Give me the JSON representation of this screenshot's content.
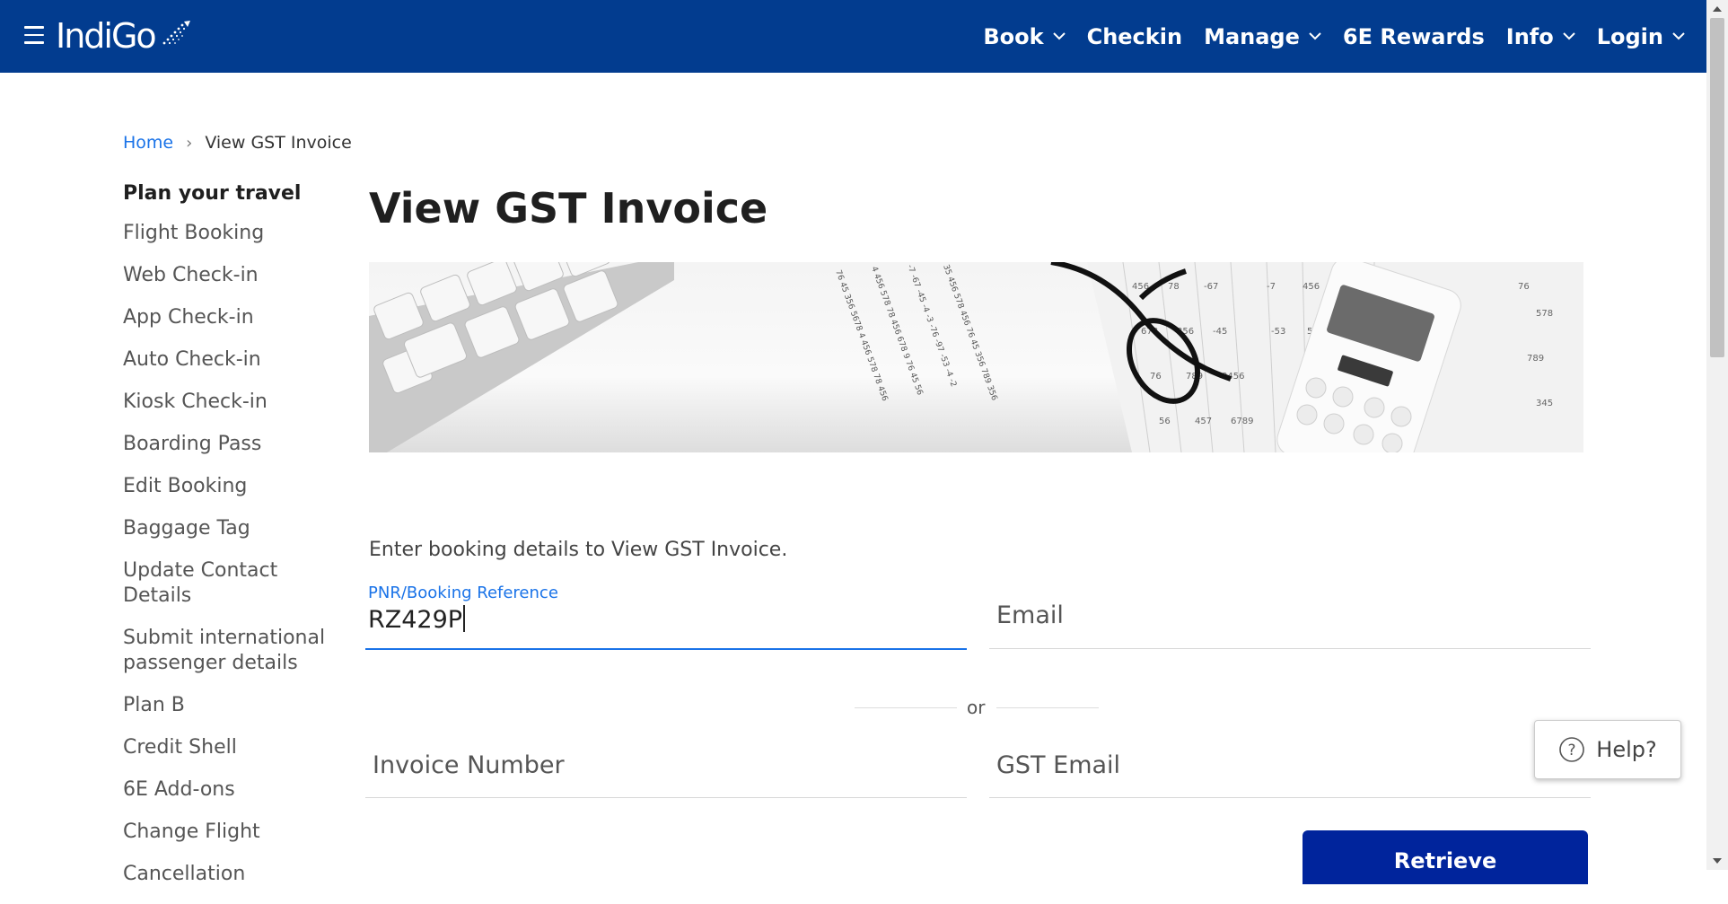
{
  "header": {
    "logo_text": "IndiGo",
    "nav": [
      {
        "label": "Book",
        "has_dropdown": true
      },
      {
        "label": "Checkin",
        "has_dropdown": false
      },
      {
        "label": "Manage",
        "has_dropdown": true
      },
      {
        "label": "6E Rewards",
        "has_dropdown": false
      },
      {
        "label": "Info",
        "has_dropdown": true
      },
      {
        "label": "Login",
        "has_dropdown": true
      }
    ],
    "bg_color": "#023c8f"
  },
  "breadcrumb": {
    "home": "Home",
    "separator": "›",
    "current": "View GST Invoice"
  },
  "sidebar": {
    "title": "Plan your travel",
    "items": [
      "Flight Booking",
      "Web Check-in",
      "App Check-in",
      "Auto Check-in",
      "Kiosk Check-in",
      "Boarding Pass",
      "Edit Booking",
      "Baggage Tag",
      "Update Contact Details",
      "Submit international passenger details",
      "Plan B",
      "Credit Shell",
      "6E Add-ons",
      "Change Flight",
      "Cancellation"
    ]
  },
  "main": {
    "title": "View GST Invoice",
    "instructions": "Enter booking details to View GST Invoice.",
    "pnr_label": "PNR/Booking Reference",
    "pnr_value": "RZ429P",
    "email_placeholder": "Email",
    "or_text": "or",
    "invoice_placeholder": "Invoice Number",
    "gst_email_placeholder": "GST Email",
    "retrieve_label": "Retrieve"
  },
  "help": {
    "label": "Help?"
  },
  "colors": {
    "brand_blue": "#023c8f",
    "link_blue": "#1a73e8",
    "button_blue": "#00249c"
  }
}
